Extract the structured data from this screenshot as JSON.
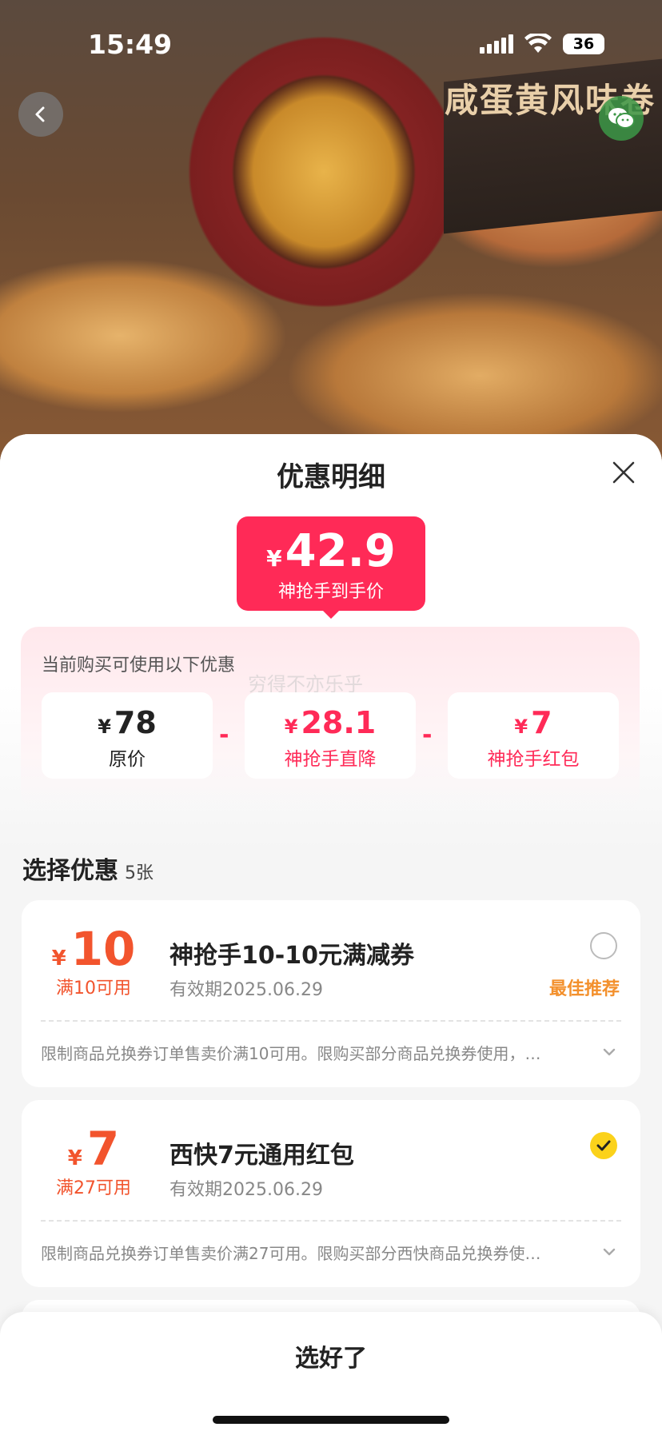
{
  "status_bar": {
    "time": "15:49",
    "battery": "36"
  },
  "hero": {
    "banner_text": "咸蛋黄风味卷"
  },
  "sheet": {
    "title": "优惠明细",
    "price": {
      "currency": "¥",
      "value": "42.9",
      "label": "神抢手到手价"
    },
    "discount_hint": "当前购买可使用以下优惠",
    "watermark": "穷得不亦乐乎",
    "breakdown": [
      {
        "currency": "¥",
        "value": "78",
        "label": "原价",
        "color": "#222222"
      },
      {
        "currency": "¥",
        "value": "28.1",
        "label": "神抢手直降",
        "color": "#ff2a57"
      },
      {
        "currency": "¥",
        "value": "7",
        "label": "神抢手红包",
        "color": "#ff2a57"
      }
    ],
    "operators": [
      "-",
      "-"
    ],
    "select_title": "选择优惠",
    "select_count": "5张",
    "coupons": [
      {
        "currency": "¥",
        "value": "10",
        "condition": "满10可用",
        "name": "神抢手10-10元满减券",
        "expiry": "有效期2025.06.29",
        "badge": "最佳推荐",
        "selected": false,
        "desc": "限制商品兑换券订单售卖价满10可用。限购买部分商品兑换券使用，…"
      },
      {
        "currency": "¥",
        "value": "7",
        "condition": "满27可用",
        "name": "西快7元通用红包",
        "expiry": "有效期2025.06.29",
        "badge": "",
        "selected": true,
        "desc": "限制商品兑换券订单售卖价满27可用。限购买部分西快商品兑换券使…"
      }
    ]
  },
  "footer": {
    "confirm_label": "选好了"
  },
  "colors": {
    "accent": "#ff2a57",
    "coupon_orange": "#f2542d",
    "badge_orange": "#f3902c",
    "check_yellow": "#fbd21b"
  }
}
